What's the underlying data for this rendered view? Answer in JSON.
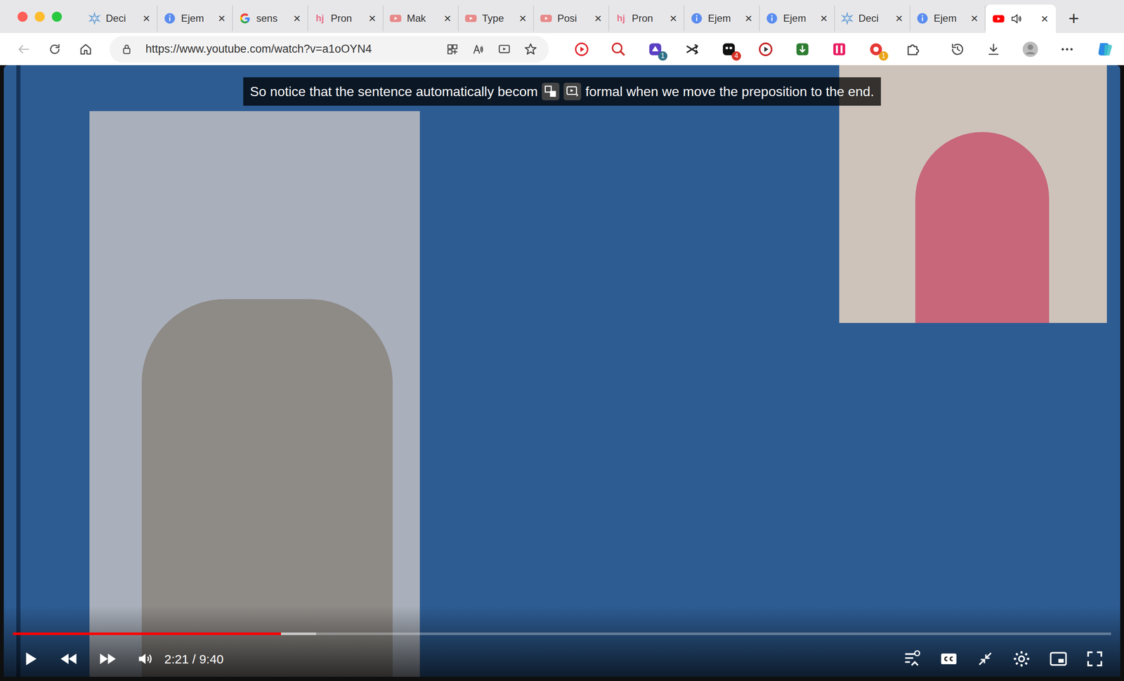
{
  "tabs": [
    {
      "label": "Deci",
      "kind": "ai",
      "selected": false
    },
    {
      "label": "Ejem",
      "kind": "info",
      "selected": false
    },
    {
      "label": "sens",
      "kind": "google",
      "selected": false
    },
    {
      "label": "Pron",
      "kind": "hj",
      "glyph": "hj",
      "selected": false
    },
    {
      "label": "Mak",
      "kind": "youtube",
      "selected": false
    },
    {
      "label": "Type",
      "kind": "youtube",
      "selected": false
    },
    {
      "label": "Posi",
      "kind": "youtube",
      "selected": false
    },
    {
      "label": "Pron",
      "kind": "hj",
      "glyph": "hj",
      "selected": false
    },
    {
      "label": "Ejem",
      "kind": "info",
      "selected": false
    },
    {
      "label": "Ejem",
      "kind": "info",
      "selected": false
    },
    {
      "label": "Deci",
      "kind": "ai",
      "selected": false
    },
    {
      "label": "Ejem",
      "kind": "info",
      "selected": false
    },
    {
      "kind": "youtube",
      "selected": true,
      "audio": true
    }
  ],
  "tab_close": "×",
  "new_tab": "+",
  "address": {
    "url": "https://www.youtube.com/watch?v=a1oOYN4"
  },
  "extensions": [
    {
      "kind": "record"
    },
    {
      "kind": "zoom"
    },
    {
      "kind": "purple",
      "badge": "1",
      "badge_color": "#2f6f86"
    },
    {
      "kind": "shuffle"
    },
    {
      "kind": "dark",
      "badge": "4",
      "badge_color": "#d93025"
    },
    {
      "kind": "redring"
    },
    {
      "kind": "green"
    },
    {
      "kind": "pink"
    },
    {
      "kind": "redcircle",
      "badge": "1",
      "badge_color": "#e8a317"
    },
    {
      "kind": "puzzle"
    }
  ],
  "caption": {
    "before": "So notice that the sentence automatically becom",
    "after": "formal when we move the preposition to the end."
  },
  "player": {
    "time": "2:21 / 9:40",
    "level": 0.244,
    "buffered": 0.276,
    "playing": false,
    "captions_on": false
  }
}
